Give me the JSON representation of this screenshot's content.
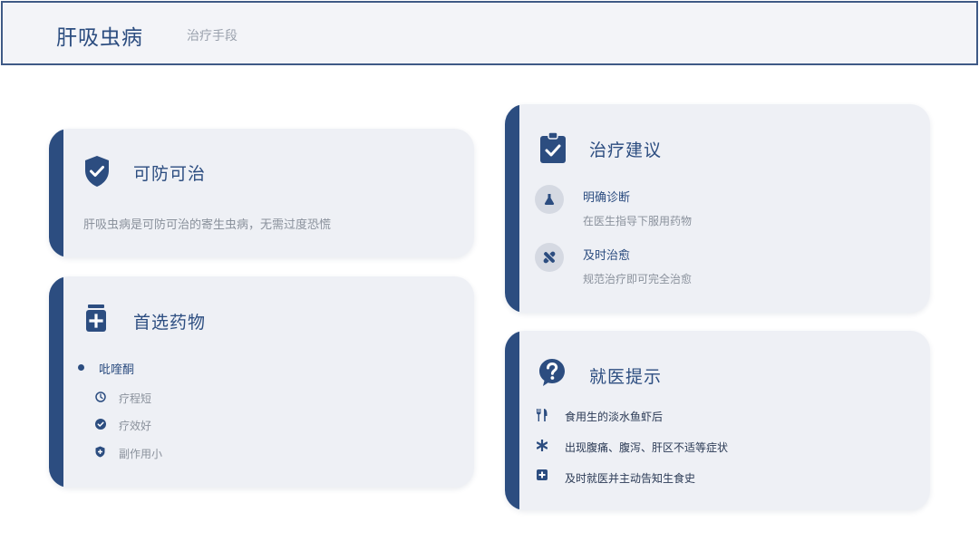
{
  "header": {
    "title": "肝吸虫病",
    "subtitle": "治疗手段"
  },
  "colors": {
    "accent": "#2c4d80",
    "card_bg": "#eef0f5",
    "icon_circle": "#d5d9e2",
    "muted_text": "#8a919c"
  },
  "cards": {
    "prevent": {
      "icon": "shield-check-icon",
      "title": "可防可治",
      "body": "肝吸虫病是可防可治的寄生虫病，无需过度恐慌"
    },
    "drug": {
      "icon": "medicine-bottle-icon",
      "title": "首选药物",
      "main_item": "吡喹酮",
      "sub_items": [
        {
          "icon": "clock-icon",
          "label": "疗程短"
        },
        {
          "icon": "check-circle-icon",
          "label": "疗效好"
        },
        {
          "icon": "shield-plus-icon",
          "label": "副作用小"
        }
      ]
    },
    "advice": {
      "icon": "clipboard-check-icon",
      "title": "治疗建议",
      "items": [
        {
          "icon": "flask-icon",
          "title": "明确诊断",
          "desc": "在医生指导下服用药物"
        },
        {
          "icon": "bandage-icon",
          "title": "及时治愈",
          "desc": "规范治疗即可完全治愈"
        }
      ]
    },
    "tips": {
      "icon": "question-circle-icon",
      "title": "就医提示",
      "items": [
        {
          "icon": "utensils-icon",
          "label": "食用生的淡水鱼虾后"
        },
        {
          "icon": "asterisk-icon",
          "label": "出现腹痛、腹泻、肝区不适等症状"
        },
        {
          "icon": "medical-plus-icon",
          "label": "及时就医并主动告知生食史"
        }
      ]
    }
  }
}
